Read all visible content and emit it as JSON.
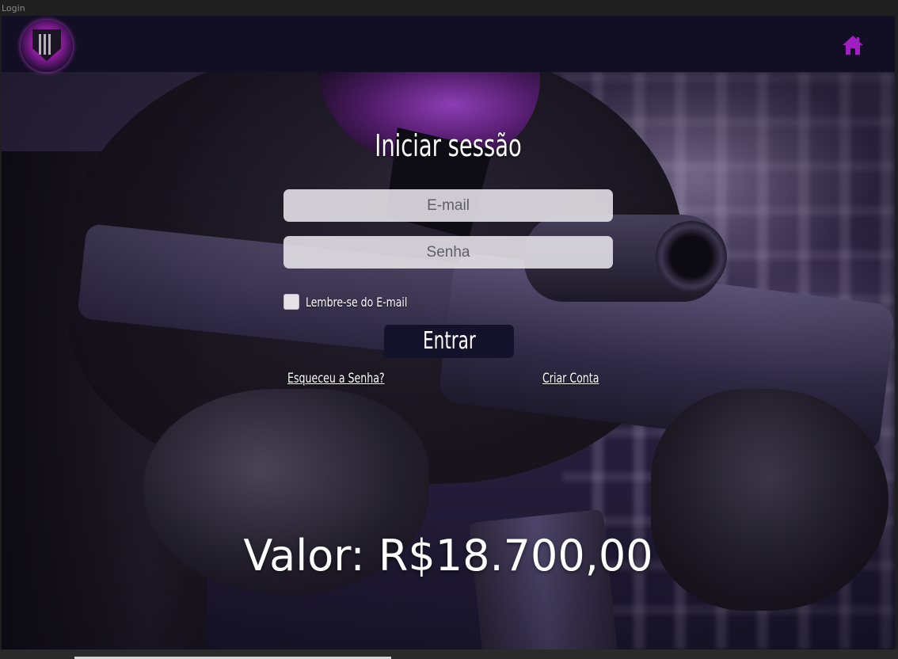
{
  "window": {
    "title": "Login"
  },
  "navbar": {
    "logo_icon": "shield-logo-icon",
    "home_icon": "home-icon",
    "accent_color": "#a01fc0"
  },
  "login": {
    "title": "Iniciar sessão",
    "email_placeholder": "E-mail",
    "password_placeholder": "Senha",
    "remember_label": "Lembre-se do E-mail",
    "remember_checked": false,
    "submit_label": "Entrar",
    "forgot_link": "Esqueceu a Senha?",
    "create_link": "Criar Conta"
  },
  "price": {
    "text": "Valor: R$18.700,00"
  }
}
